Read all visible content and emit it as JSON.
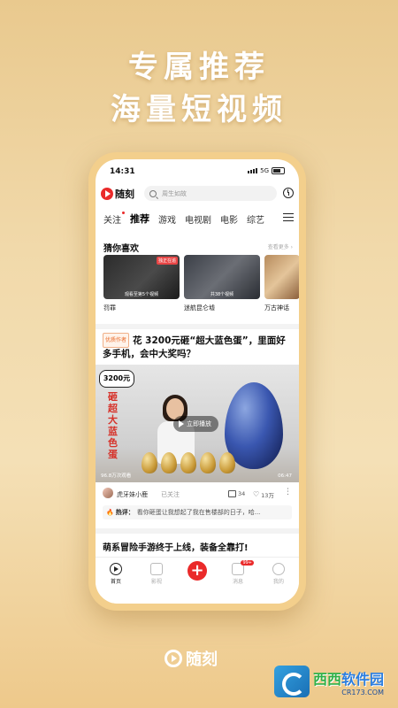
{
  "promo": {
    "line1": "专属推荐",
    "line2": "海量短视频"
  },
  "status": {
    "time": "14:31",
    "network": "5G"
  },
  "app": {
    "name": "随刻",
    "search_placeholder": "周生如故"
  },
  "tabs": [
    {
      "label": "关注"
    },
    {
      "label": "推荐",
      "active": true
    },
    {
      "label": "游戏"
    },
    {
      "label": "电视剧"
    },
    {
      "label": "电影"
    },
    {
      "label": "综艺"
    }
  ],
  "guess": {
    "title": "猜你喜欢",
    "more": "查看更多 ›",
    "items": [
      {
        "caption": "罚罪",
        "overlay": "观看至第5个视频",
        "tag": "独正在追"
      },
      {
        "caption": "迷航昆仑墟",
        "overlay": "共38个视频"
      },
      {
        "caption": "万古神话"
      }
    ]
  },
  "post": {
    "badge": "优质作者",
    "title": "花 3200元砸“超大蓝色蛋”，里面好多手机，会中大奖吗？",
    "sign": "3200元",
    "redtext": "砸超大蓝色蛋",
    "play_label": "立即播放",
    "views": "96.8万次观看",
    "duration": "06:47",
    "author": "虎牙妹小鹿",
    "follow_status": "已关注",
    "comments": "34",
    "likes": "13万",
    "hot_label": "热评：",
    "hot_text": "看你砸蛋让我想起了我在售楼部的日子，哈..."
  },
  "post2": {
    "title": "萌系冒险手游终于上线，装备全靠打!"
  },
  "tabbar": [
    {
      "label": "首页",
      "icon": "home-play-icon",
      "active": true
    },
    {
      "label": "影视",
      "icon": "film-icon"
    },
    {
      "label": "",
      "icon": "plus-icon"
    },
    {
      "label": "消息",
      "icon": "message-icon",
      "badge": "99+"
    },
    {
      "label": "我的",
      "icon": "profile-icon"
    }
  ],
  "brand": {
    "name": "随刻"
  },
  "watermark": {
    "line1a": "西西",
    "line1b": "软件园",
    "line2": "CR173.COM"
  }
}
